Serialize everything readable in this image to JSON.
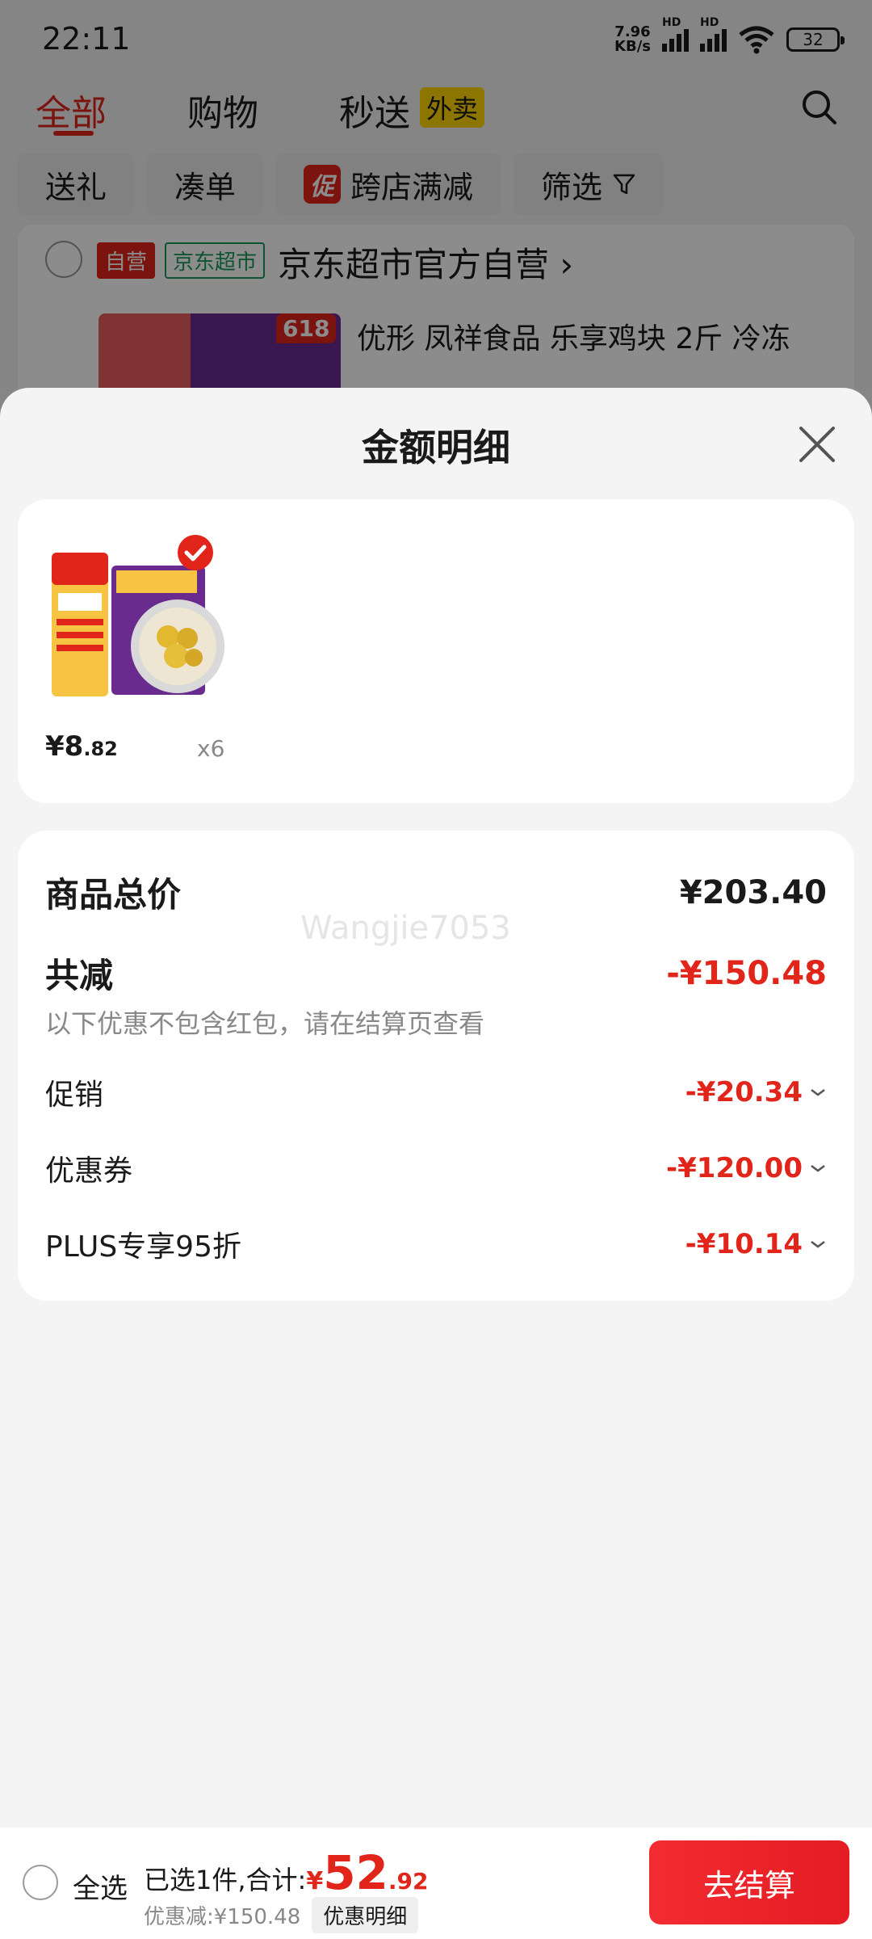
{
  "status_bar": {
    "time": "22:11",
    "net_speed_value": "7.96",
    "net_speed_unit": "KB/s",
    "hd_label": "HD",
    "battery": "32"
  },
  "header": {
    "tabs": [
      {
        "label": "全部"
      },
      {
        "label": "购物"
      },
      {
        "label": "秒送"
      }
    ],
    "waimai_badge": "外卖"
  },
  "filters": [
    {
      "label": "送礼"
    },
    {
      "label": "凑单"
    },
    {
      "label": "跨店满减",
      "badge": "促"
    },
    {
      "label": "筛选"
    }
  ],
  "store": {
    "tag_self": "自营",
    "tag_market": "京东超市",
    "name": "京东超市官方自营",
    "tag_618": "618",
    "product_title": "优形 凤祥食品 乐享鸡块 2斤 冷冻"
  },
  "sheet": {
    "title": "金额明细",
    "product": {
      "price_main": "¥8",
      "price_decimal": ".82",
      "quantity": "x6"
    },
    "details": {
      "total_label": "商品总价",
      "total_value": "¥203.40",
      "reduce_label": "共减",
      "reduce_value": "-¥150.48",
      "note": "以下优惠不包含红包，请在结算页查看",
      "items": [
        {
          "label": "促销",
          "value": "-¥20.34"
        },
        {
          "label": "优惠券",
          "value": "-¥120.00"
        },
        {
          "label": "PLUS专享95折",
          "value": "-¥10.14"
        }
      ],
      "watermark": "Wangjie7053"
    }
  },
  "bottom_bar": {
    "select_all": "全选",
    "selected_text": "已选1件,合计:",
    "total_yen": "¥",
    "total_int": "52",
    "total_dec": ".92",
    "discount_text": "优惠减:¥150.48",
    "detail_button": "优惠明细",
    "checkout_button": "去结算"
  },
  "colors": {
    "accent_red": "#e1251b",
    "waimai_yellow": "#ffd500",
    "market_green": "#1a9a5a"
  }
}
